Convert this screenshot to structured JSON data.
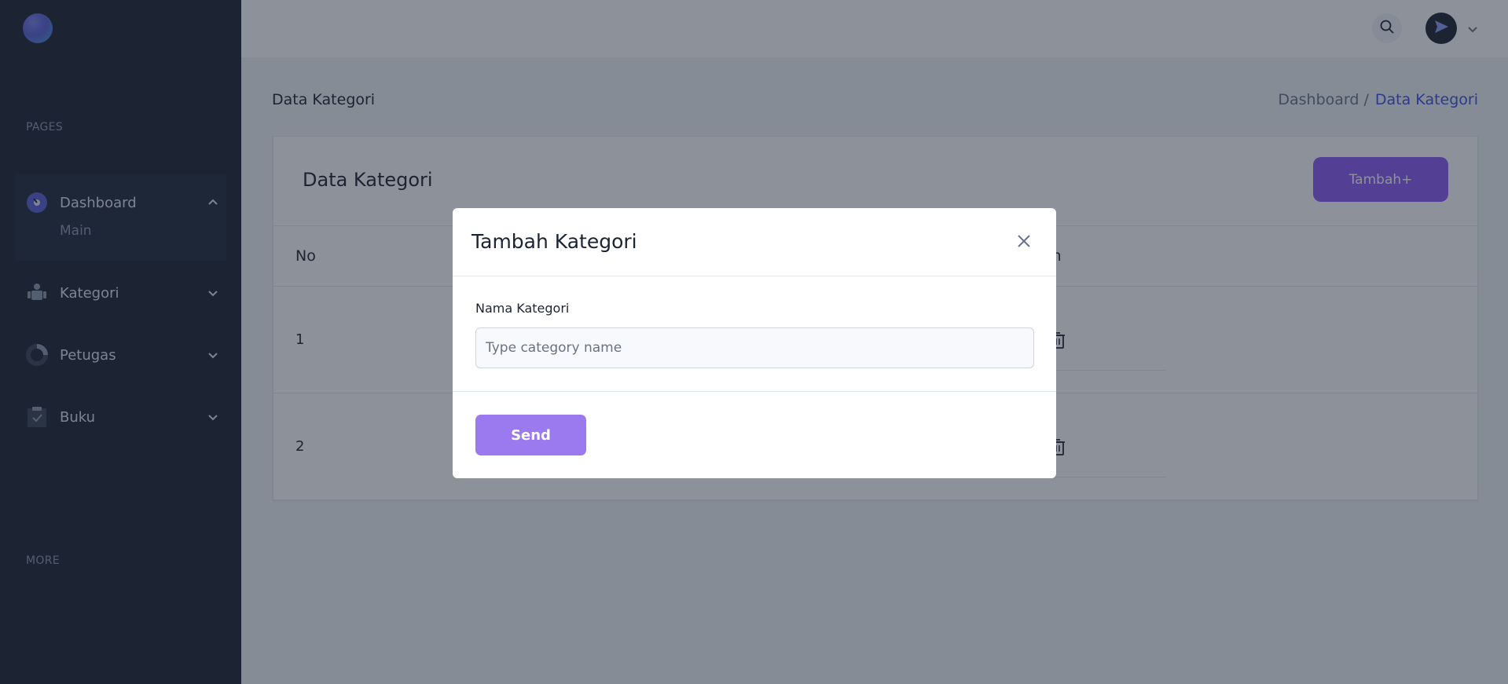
{
  "sidebar": {
    "sections": {
      "pages": "PAGES",
      "more": "MORE"
    },
    "items": [
      {
        "label": "Dashboard",
        "icon": "dashboard-icon",
        "expanded": true,
        "children": [
          "Main"
        ]
      },
      {
        "label": "Kategori",
        "icon": "category-icon",
        "expanded": false
      },
      {
        "label": "Petugas",
        "icon": "pie-chart-icon",
        "expanded": false
      },
      {
        "label": "Buku",
        "icon": "clipboard-icon",
        "expanded": false
      }
    ]
  },
  "header": {
    "search_icon": "search-icon",
    "avatar_icon": "send-icon"
  },
  "page": {
    "title": "Data Kategori",
    "breadcrumb": {
      "link": "Dashboard /",
      "current": "Data Kategori"
    }
  },
  "card": {
    "title": "Data Kategori",
    "add_button": "Tambah+",
    "columns": {
      "no": "No",
      "action": "on"
    },
    "rows": [
      {
        "no": "1"
      },
      {
        "no": "2"
      }
    ]
  },
  "modal": {
    "title": "Tambah Kategori",
    "field_label": "Nama Kategori",
    "field_placeholder": "Type category name",
    "field_value": "",
    "send_button": "Send"
  },
  "colors": {
    "sidebar_bg": "#1c2434",
    "accent_purple": "#8b5cf6",
    "send_button": "#9b79ee",
    "breadcrumb_active": "#3c50e0"
  }
}
